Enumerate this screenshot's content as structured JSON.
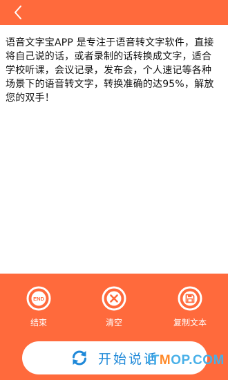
{
  "header": {
    "back_icon": "chevron-left-icon"
  },
  "content": {
    "text": "语音文字宝APP 是专注于语音转文字软件，直接将自己说的话，或者录制的话转换成文字，适合学校听课，会议记录，发布会，个人速记等各种场景下的语音转文字，转换准确的达95%，解放您的双手！"
  },
  "actions": [
    {
      "label": "结束",
      "icon": "end-icon",
      "icon_text": "END"
    },
    {
      "label": "清空",
      "icon": "clear-x-icon"
    },
    {
      "label": "复制文本",
      "icon": "save-copy-icon"
    }
  ],
  "start_button": {
    "label": "开始说话",
    "icon": "refresh-icon"
  },
  "watermark": {
    "prefix": "IT",
    "accent": "M",
    "suffix": "OP.COM"
  },
  "colors": {
    "accent": "#ff6a3c",
    "white": "#ffffff",
    "start_text": "#1e88d8"
  }
}
